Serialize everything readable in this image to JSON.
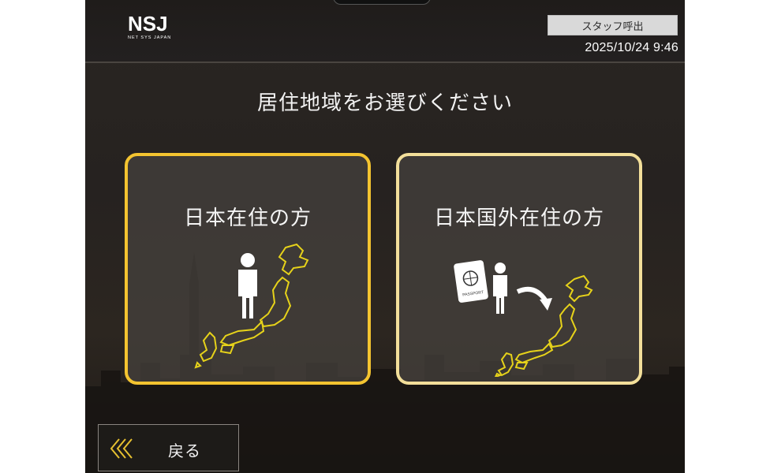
{
  "header": {
    "logo_text": "NSJ",
    "logo_subtext": "NET SYS JAPAN",
    "staff_call_label": "スタッフ呼出",
    "datetime": "2025/10/24 9:46"
  },
  "main": {
    "prompt": "居住地域をお選びください",
    "options": [
      {
        "label": "日本在住の方"
      },
      {
        "label": "日本国外在住の方"
      }
    ],
    "passport_text": "PASSPORT"
  },
  "footer": {
    "back_label": "戻る"
  },
  "colors": {
    "accent_domestic": "#f4c430",
    "accent_overseas": "#f3df9a",
    "map_outline": "#e6d21a"
  }
}
